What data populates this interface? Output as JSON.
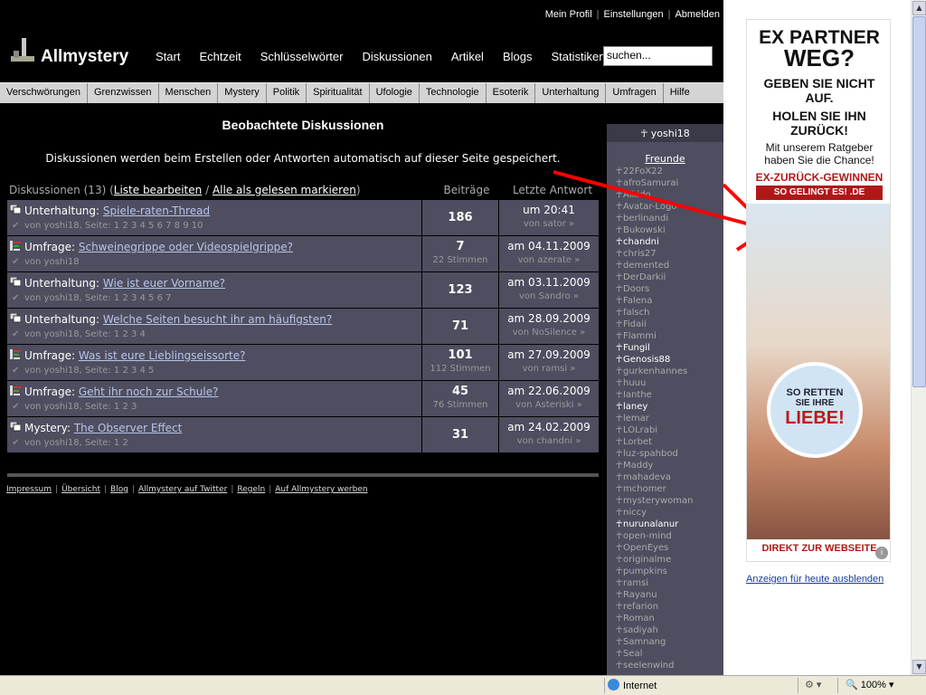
{
  "toplinks": [
    "Mein Profil",
    "Einstellungen",
    "Abmelden"
  ],
  "logo": "Allmystery",
  "mainnav": [
    "Start",
    "Echtzeit",
    "Schlüsselwörter",
    "Diskussionen",
    "Artikel",
    "Blogs",
    "Statistiken"
  ],
  "search": {
    "value": "suchen..."
  },
  "categories": [
    "Verschwörungen",
    "Grenzwissen",
    "Menschen",
    "Mystery",
    "Politik",
    "Spiritualität",
    "Ufologie",
    "Technologie",
    "Esoterik",
    "Unterhaltung",
    "Umfragen",
    "Hilfe"
  ],
  "heading": "Beobachtete Diskussionen",
  "info": "Diskussionen werden beim Erstellen oder Antworten automatisch auf dieser Seite gespeichert.",
  "list": {
    "label": "Diskussionen",
    "count": "(13)",
    "edit": "Liste bearbeiten",
    "markread": "Alle als gelesen markieren",
    "col_posts": "Beiträge",
    "col_last": "Letzte Antwort"
  },
  "threads": [
    {
      "category": "Unterhaltung:",
      "title": "Spiele-raten-Thread",
      "sub": "von yoshi18, Seite: 1 2 3 4 5 6 7 8 9 10",
      "posts": "186",
      "votes": "",
      "date": "um 20:41",
      "by": "von sator",
      "poll": false
    },
    {
      "category": "Umfrage:",
      "title": "Schweinegrippe oder Videospielgrippe?",
      "sub": "von yoshi18",
      "posts": "7",
      "votes": "22 Stimmen",
      "date": "am 04.11.2009",
      "by": "von azerate",
      "poll": true
    },
    {
      "category": "Unterhaltung:",
      "title": "Wie ist euer Vorname?",
      "sub": "von yoshi18, Seite: 1 2 3 4 5 6 7",
      "posts": "123",
      "votes": "",
      "date": "am 03.11.2009",
      "by": "von Sandro",
      "poll": false
    },
    {
      "category": "Unterhaltung:",
      "title": "Welche Seiten besucht ihr am häufigsten?",
      "sub": "von yoshi18, Seite: 1 2 3 4",
      "posts": "71",
      "votes": "",
      "date": "am 28.09.2009",
      "by": "von NoSilence",
      "poll": false
    },
    {
      "category": "Umfrage:",
      "title": "Was ist eure Lieblingseissorte?",
      "sub": "von yoshi18, Seite: 1 2 3 4 5",
      "posts": "101",
      "votes": "112 Stimmen",
      "date": "am 27.09.2009",
      "by": "von ramsi",
      "poll": true
    },
    {
      "category": "Umfrage:",
      "title": "Geht ihr noch zur Schule?",
      "sub": "von yoshi18, Seite: 1 2 3",
      "posts": "45",
      "votes": "76 Stimmen",
      "date": "am 22.06.2009",
      "by": "von Asteriski",
      "poll": true
    },
    {
      "category": "Mystery:",
      "title": "The Observer Effect",
      "sub": "von yoshi18, Seite: 1 2",
      "posts": "31",
      "votes": "",
      "date": "am 24.02.2009",
      "by": "von chandni",
      "poll": false
    }
  ],
  "footer": [
    "Impressum",
    "Übersicht",
    "Blog",
    "Allmystery auf Twitter",
    "Regeln",
    "Auf Allmystery werben"
  ],
  "sidebar": {
    "username": "yoshi18",
    "friends_label": "Freunde",
    "friends": [
      {
        "name": "22FoX22",
        "online": false
      },
      {
        "name": "afroSamurai",
        "online": false
      },
      {
        "name": "Aikido",
        "online": false
      },
      {
        "name": "Avatar-Logo",
        "online": false
      },
      {
        "name": "berlinandi",
        "online": false
      },
      {
        "name": "Bukowski",
        "online": false
      },
      {
        "name": "chandni",
        "online": true
      },
      {
        "name": "chris27",
        "online": false
      },
      {
        "name": "demented",
        "online": false
      },
      {
        "name": "DerDarkii",
        "online": false
      },
      {
        "name": "Doors",
        "online": false
      },
      {
        "name": "Falena",
        "online": false
      },
      {
        "name": "falsch",
        "online": false
      },
      {
        "name": "Fidaii",
        "online": false
      },
      {
        "name": "Flammi",
        "online": false
      },
      {
        "name": "Fungil",
        "online": true
      },
      {
        "name": "Genosis88",
        "online": true
      },
      {
        "name": "gurkenhannes",
        "online": false
      },
      {
        "name": "huuu",
        "online": false
      },
      {
        "name": "Ianthe",
        "online": false
      },
      {
        "name": "laney",
        "online": true
      },
      {
        "name": "lemar",
        "online": false
      },
      {
        "name": "LOLrabi",
        "online": false
      },
      {
        "name": "Lorbet",
        "online": false
      },
      {
        "name": "luz-spahbod",
        "online": false
      },
      {
        "name": "Maddy",
        "online": false
      },
      {
        "name": "mahadeva",
        "online": false
      },
      {
        "name": "mchomer",
        "online": false
      },
      {
        "name": "mysterywoman",
        "online": false
      },
      {
        "name": "niccy",
        "online": false
      },
      {
        "name": "nurunalanur",
        "online": true
      },
      {
        "name": "open-mind",
        "online": false
      },
      {
        "name": "OpenEyes",
        "online": false
      },
      {
        "name": "originalme",
        "online": false
      },
      {
        "name": "pumpkins",
        "online": false
      },
      {
        "name": "ramsi",
        "online": false
      },
      {
        "name": "Rayanu",
        "online": false
      },
      {
        "name": "refarion",
        "online": false
      },
      {
        "name": "Roman",
        "online": false
      },
      {
        "name": "sadiyah",
        "online": false
      },
      {
        "name": "Samnang",
        "online": false
      },
      {
        "name": "Seal",
        "online": false
      },
      {
        "name": "seelenwind",
        "online": false
      }
    ]
  },
  "ad": {
    "line1": "EX PARTNER",
    "line2": "WEG?",
    "line3": "GEBEN SIE NICHT",
    "line4": "AUF.",
    "line5": "HOLEN SIE IHN",
    "line6": "ZURÜCK!",
    "line7": "Mit unserem Ratgeber",
    "line8": "haben Sie die Chance!",
    "brand": "EX-ZURÜCK-GEWINNEN",
    "brand_sub": "SO GELINGT ES!     .DE",
    "seal1": "SO RETTEN",
    "seal2": "SIE IHRE",
    "seal3": "LIEBE!",
    "cta": "DIREKT ZUR WEBSEITE",
    "info": "i",
    "hide": "Anzeigen für heute ausblenden"
  },
  "status": {
    "zone": "Internet",
    "zoom": "100%"
  }
}
